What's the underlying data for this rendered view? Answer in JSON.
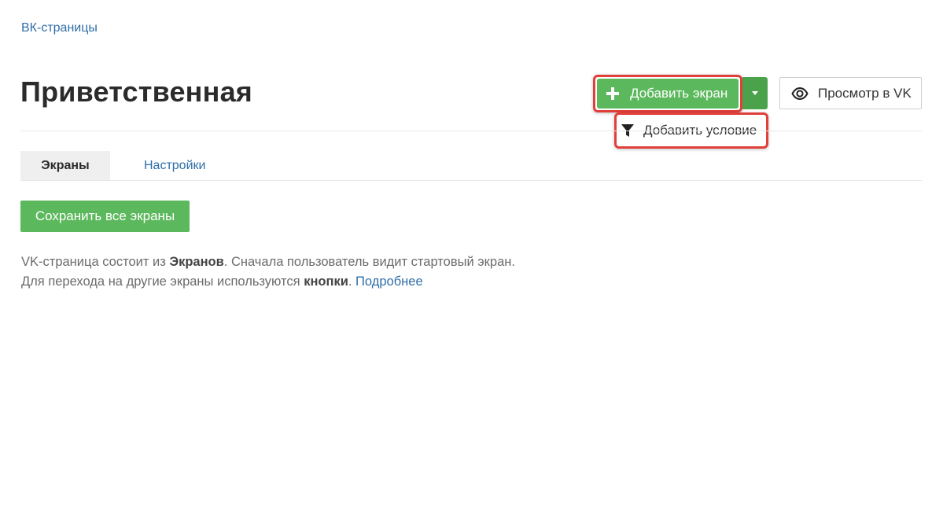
{
  "breadcrumb": {
    "label": "ВК-страницы"
  },
  "header": {
    "title": "Приветственная",
    "add_screen_label": "Добавить экран",
    "preview_label": "Просмотр в VK"
  },
  "dropdown": {
    "items": [
      {
        "label": "Добавить условие",
        "icon": "filter-icon"
      }
    ]
  },
  "tabs": [
    {
      "label": "Экраны",
      "active": true
    },
    {
      "label": "Настройки",
      "active": false
    }
  ],
  "actions": {
    "save_all_label": "Сохранить все экраны"
  },
  "help": {
    "line1_part1": "VK-страница состоит из ",
    "line1_bold": "Экранов",
    "line1_part2": ". Сначала пользователь видит стартовый экран.",
    "line2_part1": "Для перехода на другие экраны используются ",
    "line2_bold": "кнопки",
    "line2_part2": ". ",
    "more_link": "Подробнее"
  },
  "colors": {
    "accent_green": "#5cb85c",
    "link_blue": "#2f6ea8",
    "highlight_red": "#e0403a"
  }
}
